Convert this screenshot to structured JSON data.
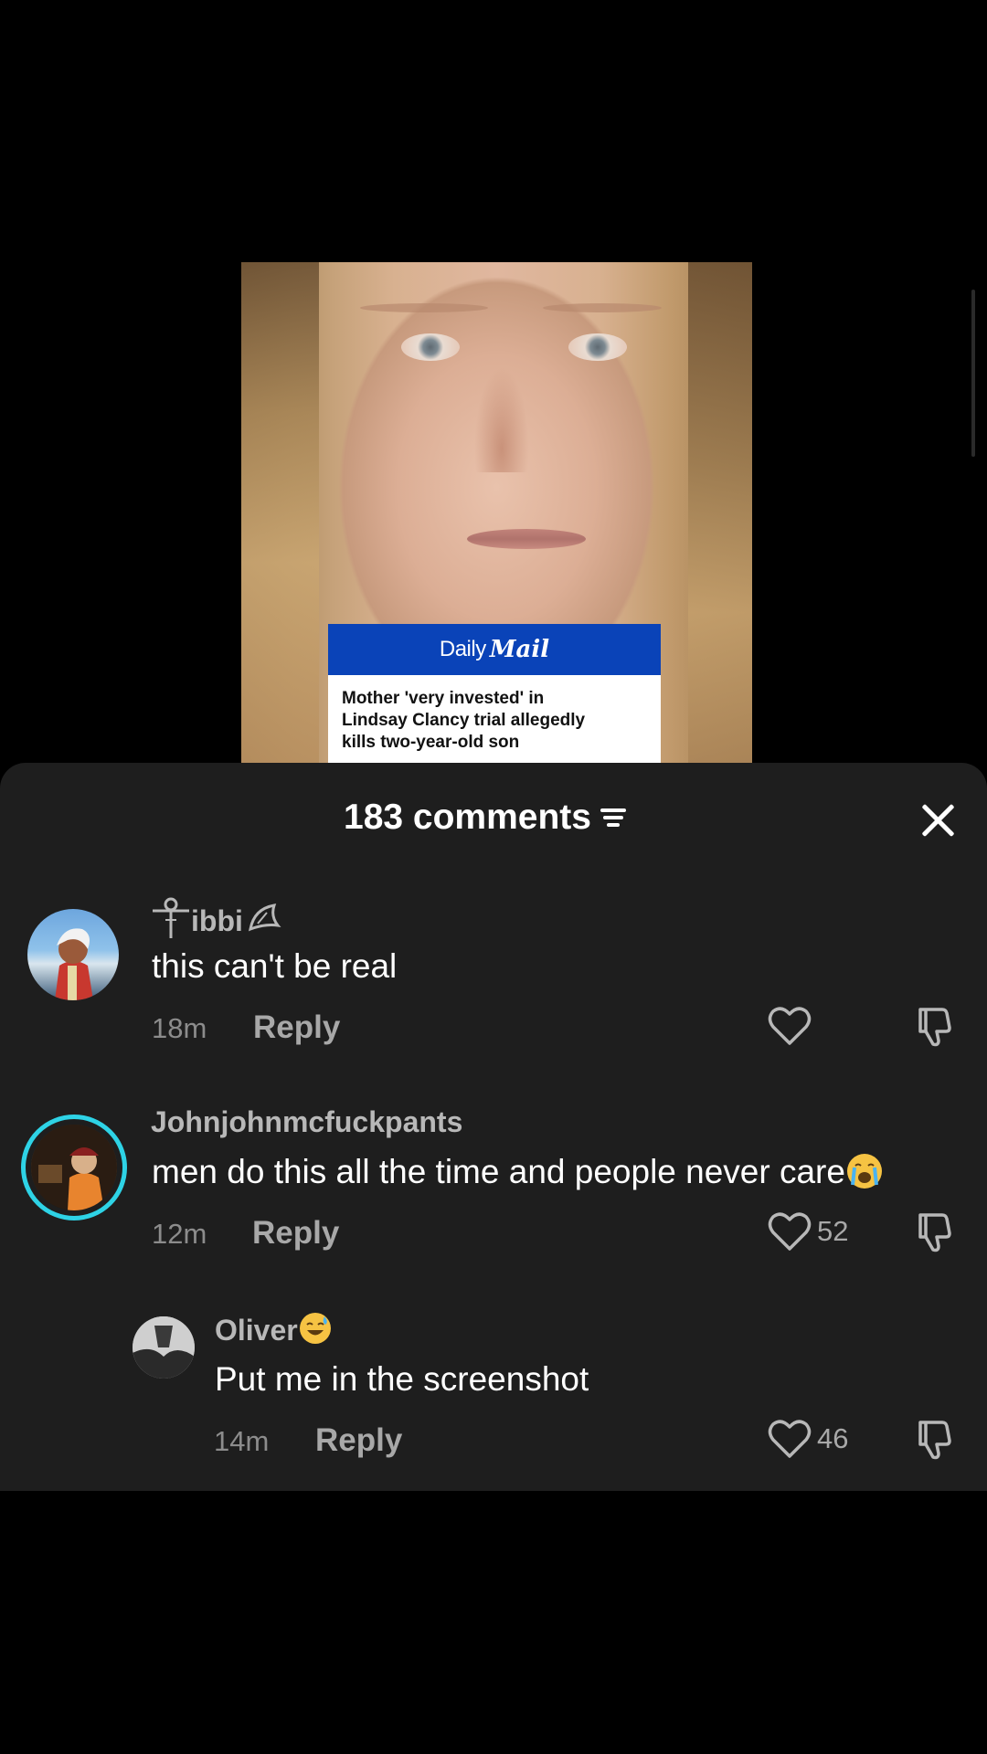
{
  "post": {
    "brand": {
      "daily": "Daily",
      "mail": "Mail"
    },
    "headline_lines": [
      "Mother 'very invested' in",
      "Lindsay Clancy trial allegedly",
      "kills two-year-old son"
    ],
    "colors": {
      "brand_blue": "#0a43b8"
    }
  },
  "comments_sheet": {
    "title": "183 comments",
    "sort_icon": "sort-lines-icon",
    "close_icon": "close-icon",
    "colors": {
      "sheet_bg": "#1e1e1e",
      "text_primary": "#ffffff",
      "text_muted": "#8c8c8c",
      "avatar_ring": "#2ed3e6"
    },
    "comments": [
      {
        "username": "ibbi",
        "username_prefix_icon": "ankh-symbol-icon",
        "username_suffix_icon": "croissant-symbol-icon",
        "text": "this can't be real",
        "time": "18m",
        "reply_label": "Reply",
        "likes": "",
        "like_icon": "heart-outline-icon",
        "dislike_icon": "thumbs-down-icon"
      },
      {
        "username": "Johnjohnmcfuckpants",
        "text": "men do this all the time and people never care",
        "text_emoji": "loudly-crying-face-emoji",
        "time": "12m",
        "reply_label": "Reply",
        "likes": "52",
        "like_icon": "heart-outline-icon",
        "dislike_icon": "thumbs-down-icon",
        "has_story_ring": true
      },
      {
        "username": "Oliver",
        "username_emoji": "grinning-sweat-face-emoji",
        "text": "Put me in the screenshot",
        "time": "14m",
        "reply_label": "Reply",
        "likes": "46",
        "like_icon": "heart-outline-icon",
        "dislike_icon": "thumbs-down-icon",
        "is_reply": true
      }
    ]
  }
}
